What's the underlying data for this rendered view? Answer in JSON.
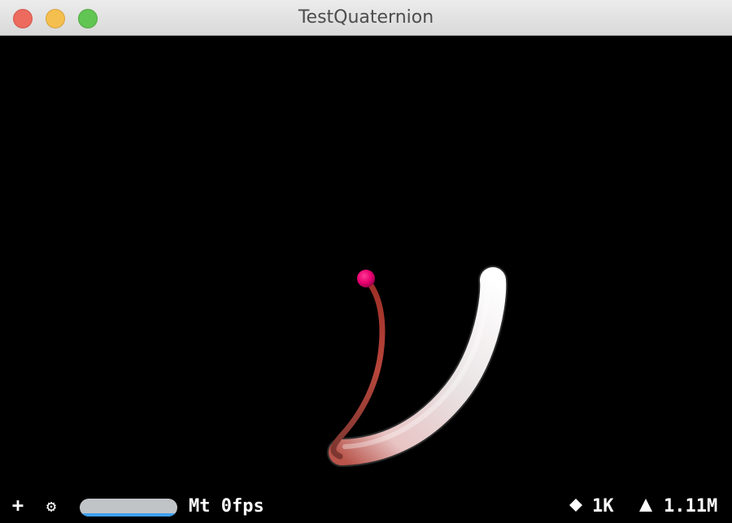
{
  "window": {
    "title": "TestQuaternion"
  },
  "colors": {
    "background": "#000000",
    "sphere": "#e8006e",
    "tube_start": "#ffffff",
    "tube_end": "#b8544a",
    "thin_curve": "#b03a30",
    "perf_bar": "#c1c4c7",
    "perf_fill": "#3da0f0"
  },
  "stats_bar": {
    "add_icon": "plus-icon",
    "settings_icon": "gear-icon",
    "renderer_fps": "Mt 0fps",
    "performance_fraction": 1.0,
    "nodes_icon": "diamond-icon",
    "nodes_count": "1K",
    "triangles_icon": "triangle-icon",
    "triangles_count": "1.11M"
  }
}
